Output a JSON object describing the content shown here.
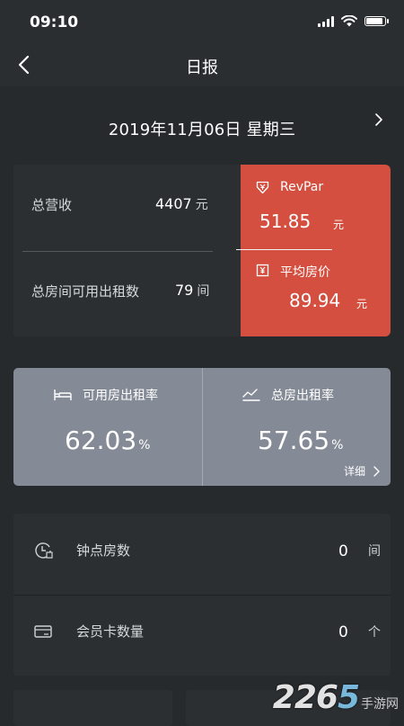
{
  "status_bar": {
    "time": "09:10"
  },
  "nav": {
    "title": "日报"
  },
  "date": {
    "text": "2019年11月06日  星期三"
  },
  "summary": {
    "revenue_label": "总营收",
    "revenue_value": "4407",
    "revenue_unit": "元",
    "rooms_label": "总房间可用出租数",
    "rooms_value": "79",
    "rooms_unit": "间"
  },
  "highlight": {
    "revpar_label": "RevPar",
    "revpar_value": "51.85",
    "revpar_unit": "元",
    "adr_label": "平均房价",
    "adr_value": "89.94",
    "adr_unit": "元",
    "color": "#d44f3f"
  },
  "rates": {
    "available_label": "可用房出租率",
    "available_value": "62.03",
    "total_label": "总房出租率",
    "total_value": "57.65",
    "percent_sign": "%",
    "detail_label": "详细",
    "color": "#858b96"
  },
  "list": {
    "hourly_label": "钟点房数",
    "hourly_value": "0",
    "hourly_unit": "间",
    "member_label": "会员卡数量",
    "member_value": "0",
    "member_unit": "个"
  },
  "watermark": {
    "number_prefix": "226",
    "number_accent": "5",
    "text": "手游网"
  }
}
